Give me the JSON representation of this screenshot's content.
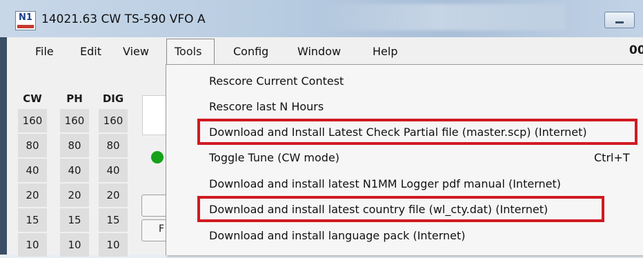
{
  "window": {
    "title": "14021.63 CW TS-590 VFO A",
    "logo_text": "N1"
  },
  "menubar": {
    "items": [
      "File",
      "Edit",
      "View",
      "Tools",
      "Config",
      "Window",
      "Help"
    ],
    "right_text": "00"
  },
  "bands": {
    "headers": [
      "CW",
      "PH",
      "DIG"
    ],
    "values": [
      "160",
      "80",
      "40",
      "20",
      "15",
      "10"
    ]
  },
  "tools_menu": {
    "items": [
      {
        "label": "Rescore Current Contest",
        "shortcut": ""
      },
      {
        "label": "Rescore last N Hours",
        "shortcut": ""
      },
      {
        "label": "Download and Install Latest Check Partial file (master.scp) (Internet)",
        "shortcut": "",
        "highlighted": true
      },
      {
        "label": "Toggle Tune (CW mode)",
        "shortcut": "Ctrl+T"
      },
      {
        "label": "Download and install latest N1MM Logger pdf manual (Internet)",
        "shortcut": ""
      },
      {
        "label": "Download and install latest country file (wl_cty.dat) (Internet)",
        "shortcut": "",
        "highlighted": true
      },
      {
        "label": "Download and install language pack (Internet)",
        "shortcut": ""
      }
    ]
  },
  "colors": {
    "highlight": "#d01a21",
    "status_led": "#16a11a"
  },
  "partial_button_glyph": "F"
}
